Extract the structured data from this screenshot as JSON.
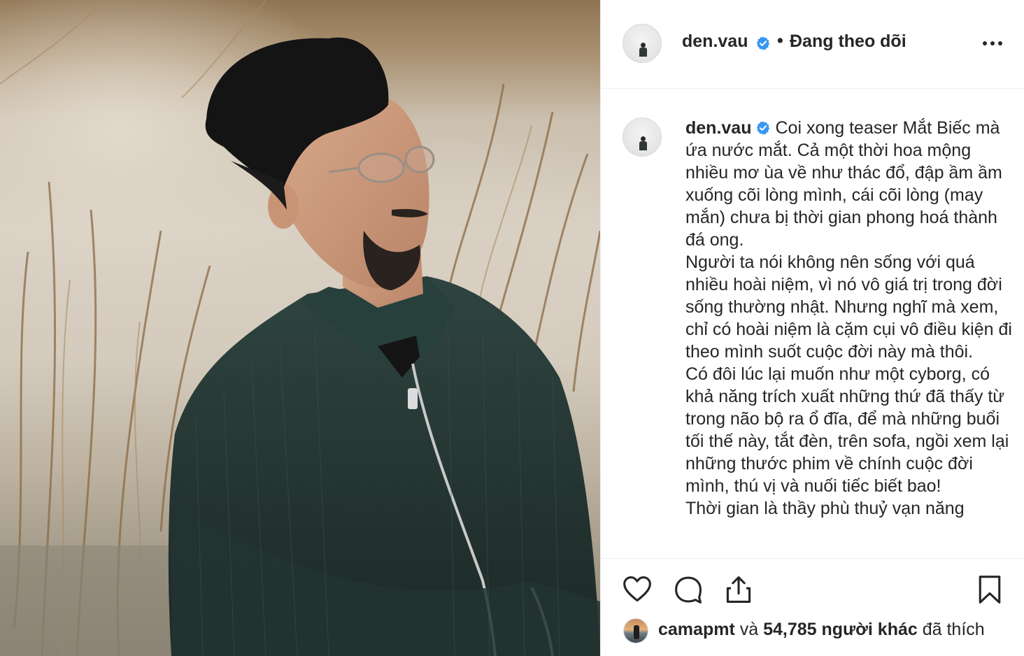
{
  "post": {
    "author": "den.vau",
    "follow_status": "Đang theo dõi",
    "separator": "•",
    "verified_icon": "verified-badge-icon",
    "more_icon": "more-options-icon"
  },
  "caption": {
    "author": "den.vau",
    "text": "Coi xong teaser Mắt Biếc mà ứa nước mắt. Cả một thời hoa mộng nhiều mơ ùa về như thác đổ, đập ầm ầm xuống cõi lòng mình, cái cõi lòng (may mắn) chưa bị thời gian phong hoá thành đá ong.\nNgười ta nói không nên sống với quá nhiều hoài niệm, vì nó vô giá trị trong đời sống thường nhật. Nhưng nghĩ mà xem, chỉ có hoài niệm là cặm cụi vô điều kiện đi theo mình suốt cuộc đời này mà thôi.\nCó đôi lúc lại muốn như một cyborg, có khả năng trích xuất những thứ đã thấy từ trong não bộ ra ổ đĩa, để mà những buổi tối thế này, tắt đèn, trên sofa, ngồi xem lại những thước phim về chính cuộc đời mình, thú vị và nuối tiếc biết bao!\nThời gian là thầy phù thuỷ vạn năng"
  },
  "actions": {
    "like_icon": "heart-icon",
    "comment_icon": "comment-icon",
    "share_icon": "share-icon",
    "save_icon": "bookmark-icon"
  },
  "likes": {
    "liker": "camapmt",
    "connector": " và ",
    "count": "54,785",
    "suffix_bold": " người khác",
    "suffix": " đã thích"
  },
  "colors": {
    "text": "#262626",
    "verified_blue": "#3897f0",
    "border": "#efefef"
  }
}
